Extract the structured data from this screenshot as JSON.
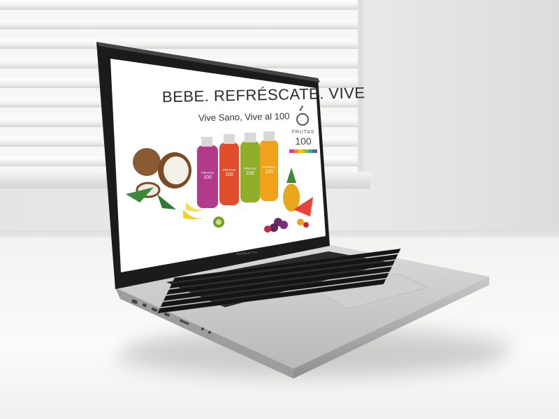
{
  "screen_ad": {
    "headline": "BEBE. REFRÉSCATE. VIVE",
    "tagline": "Vive Sano, Vive al 100",
    "brand_name": "FRUTAS",
    "brand_number": "100",
    "brand_bar_colors": [
      "#e03c8c",
      "#f28c1e",
      "#f7c500",
      "#8cbf3f",
      "#2fa6a0",
      "#7a4fa0"
    ],
    "bottles": [
      {
        "name": "FRUTAS",
        "number": "100",
        "color": "#b23a8a"
      },
      {
        "name": "FRUTAS",
        "number": "100",
        "color": "#e24d2c"
      },
      {
        "name": "FRUTAS",
        "number": "100",
        "color": "#8fae2a"
      },
      {
        "name": "FRUTAS",
        "number": "100",
        "color": "#f2a21a"
      }
    ]
  },
  "laptop": {
    "model_label": "MacBook Pro"
  }
}
